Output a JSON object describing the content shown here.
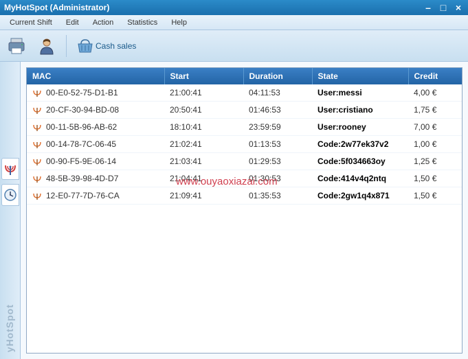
{
  "window": {
    "title": "MyHotSpot   (Administrator)"
  },
  "menu": {
    "items": [
      "Current Shift",
      "Edit",
      "Action",
      "Statistics",
      "Help"
    ]
  },
  "toolbar": {
    "cash_sales_label": "Cash sales"
  },
  "table": {
    "headers": {
      "mac": "MAC",
      "start": "Start",
      "duration": "Duration",
      "state": "State",
      "credit": "Credit"
    },
    "rows": [
      {
        "mac": "00-E0-52-75-D1-B1",
        "start": "21:00:41",
        "duration": "04:11:53",
        "state": "User:messi",
        "credit": "4,00 €"
      },
      {
        "mac": "20-CF-30-94-BD-08",
        "start": "20:50:41",
        "duration": "01:46:53",
        "state": "User:cristiano",
        "credit": "1,75 €"
      },
      {
        "mac": "00-11-5B-96-AB-62",
        "start": "18:10:41",
        "duration": "23:59:59",
        "state": "User:rooney",
        "credit": "7,00 €"
      },
      {
        "mac": "00-14-78-7C-06-45",
        "start": "21:02:41",
        "duration": "01:13:53",
        "state": "Code:2w77ek37v2",
        "credit": "1,00 €"
      },
      {
        "mac": "00-90-F5-9E-06-14",
        "start": "21:03:41",
        "duration": "01:29:53",
        "state": "Code:5f034663oy",
        "credit": "1,25 €"
      },
      {
        "mac": "48-5B-39-98-4D-D7",
        "start": "21:04:41",
        "duration": "01:30:53",
        "state": "Code:414v4q2ntq",
        "credit": "1,50 €"
      },
      {
        "mac": "12-E0-77-7D-76-CA",
        "start": "21:09:41",
        "duration": "01:35:53",
        "state": "Code:2gw1q4x871",
        "credit": "1,50 €"
      }
    ]
  },
  "sidebar": {
    "vertical_text": "yHotSpot"
  },
  "watermark": "www.ouyaoxiazai.com"
}
